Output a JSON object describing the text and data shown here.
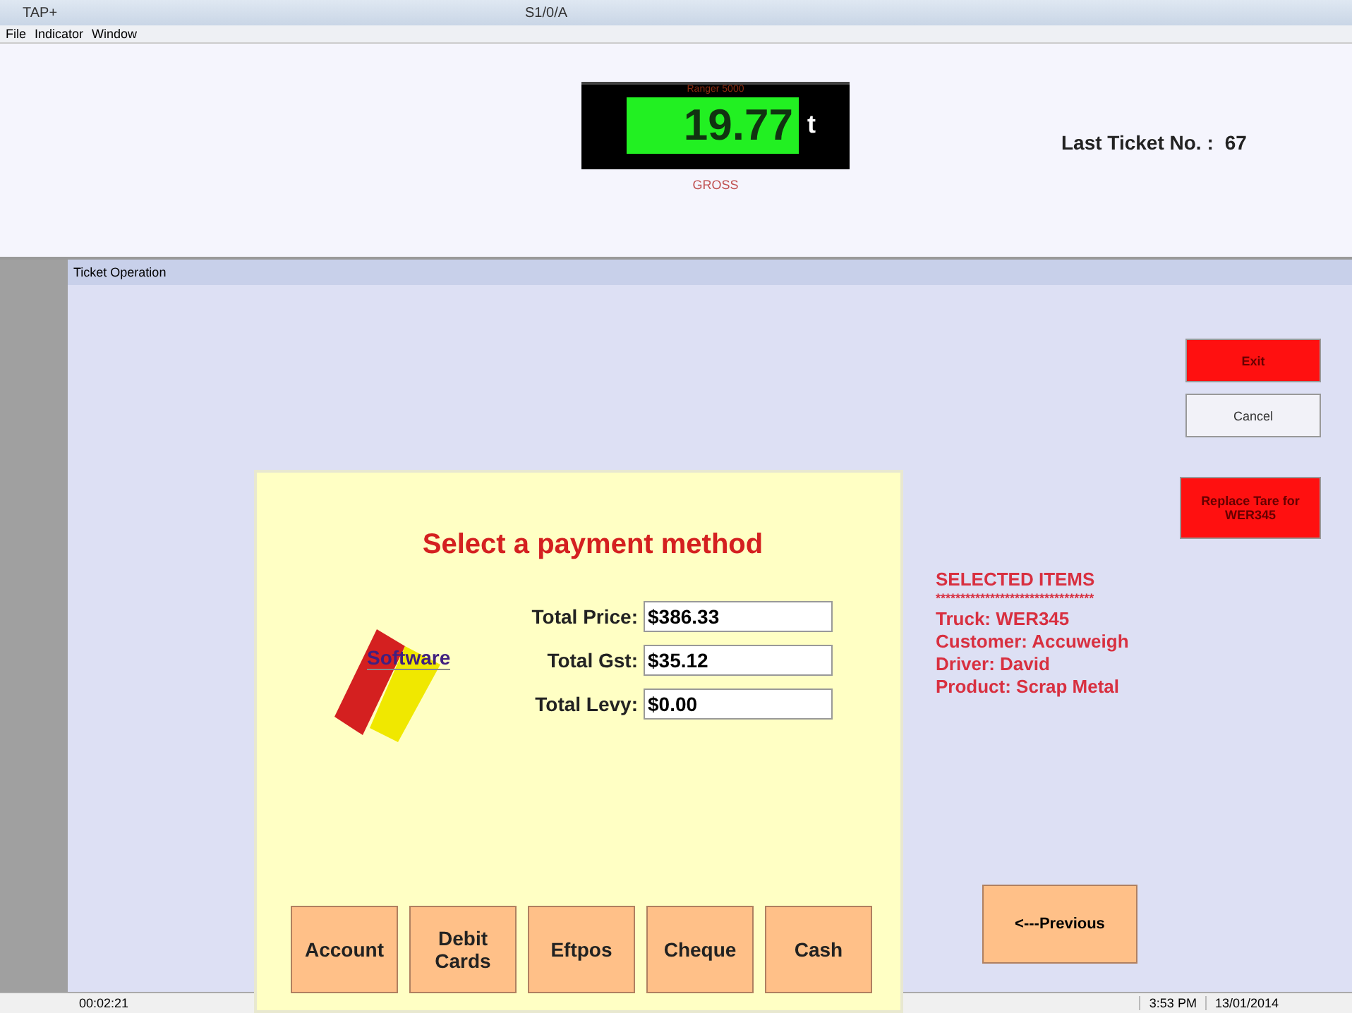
{
  "window": {
    "title": "TAP+",
    "center_title": "S1/0/A"
  },
  "menu": [
    "File",
    "Indicator",
    "Window"
  ],
  "indicator": {
    "caption": "Ranger 5000",
    "reading": "19.77",
    "unit": "t",
    "mode": "GROSS"
  },
  "last_ticket": {
    "label": "Last Ticket No. :",
    "value": "67"
  },
  "panel": {
    "title": "Ticket Operation"
  },
  "side_buttons": [
    {
      "label": "Exit",
      "kind": "alert"
    },
    {
      "label": "Cancel",
      "kind": "plain"
    },
    {
      "label": "Replace Tare for WER345",
      "kind": "alert"
    }
  ],
  "selected_items": {
    "title": "SELECTED ITEMS",
    "separator": "********************************",
    "lines": [
      "Truck: WER345",
      "Customer: Accuweigh",
      "Driver: David",
      "Product: Scrap Metal"
    ]
  },
  "previous_button": "<---Previous",
  "dialog": {
    "title": "Select a payment method",
    "logo_text": "Software",
    "fields": [
      {
        "label": "Total Price:",
        "value": "$386.33"
      },
      {
        "label": "Total Gst:",
        "value": "$35.12"
      },
      {
        "label": "Total Levy:",
        "value": "$0.00"
      }
    ],
    "buttons": [
      "Account",
      "Debit Cards",
      "Eftpos",
      "Cheque",
      "Cash"
    ]
  },
  "status_bar": {
    "elapsed": "00:02:21",
    "time": "3:53 PM",
    "date": "13/01/2014"
  }
}
